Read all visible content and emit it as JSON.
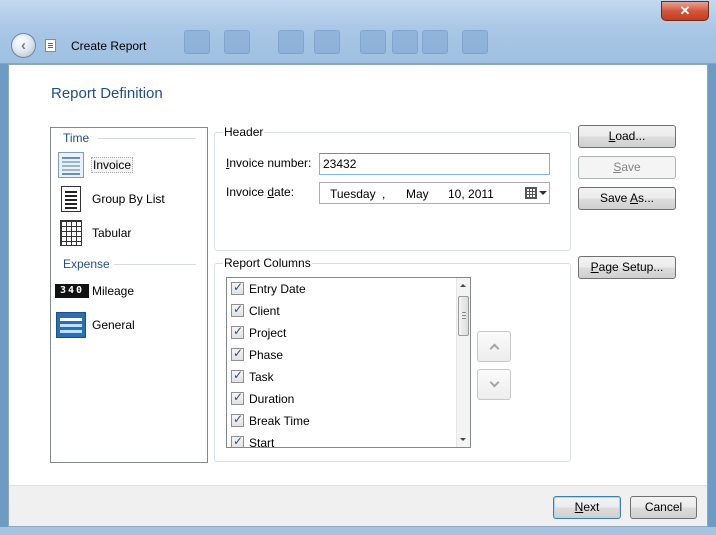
{
  "window": {
    "title": "Create Report",
    "close_glyph": "✕",
    "back_glyph": "‹"
  },
  "page": {
    "title": "Report Definition"
  },
  "categories": {
    "time_header": "Time",
    "expense_header": "Expense",
    "items": [
      {
        "label": "Invoice",
        "icon": "invoice-icon",
        "selected": true
      },
      {
        "label": "Group By List",
        "icon": "list-icon"
      },
      {
        "label": "Tabular",
        "icon": "table-icon"
      },
      {
        "label": "Mileage",
        "icon": "odometer-icon",
        "icon_text": "340"
      },
      {
        "label": "General",
        "icon": "form-icon"
      }
    ]
  },
  "header_group": {
    "title": "Header",
    "invoice_number_label_underlined": "I",
    "invoice_number_label_rest": "nvoice number:",
    "invoice_number_value": "23432",
    "invoice_date_label_a": "Invoice ",
    "invoice_date_label_underlined": "d",
    "invoice_date_label_b": "ate:",
    "date": {
      "weekday": "Tuesday",
      "comma": ",",
      "month": "May",
      "day_year": "10, 2011"
    }
  },
  "columns_group": {
    "title": "Report Columns",
    "items": [
      {
        "label": "Entry Date",
        "checked": true
      },
      {
        "label": "Client",
        "checked": true
      },
      {
        "label": "Project",
        "checked": true
      },
      {
        "label": "Phase",
        "checked": true
      },
      {
        "label": "Task",
        "checked": true
      },
      {
        "label": "Duration",
        "checked": true
      },
      {
        "label": "Break Time",
        "checked": true
      },
      {
        "label": "Start",
        "checked": true
      }
    ]
  },
  "buttons": {
    "load_u": "L",
    "load_rest": "oad...",
    "save_u": "S",
    "save_rest": "ave",
    "saveas_a": "Save ",
    "saveas_u": "A",
    "saveas_b": "s...",
    "pagesetup_a": "",
    "pagesetup_u": "P",
    "pagesetup_b": "age Setup...",
    "next_u": "N",
    "next_rest": "ext",
    "cancel": "Cancel"
  },
  "colors": {
    "accent": "#1f4e8c",
    "check": "#2a4d86"
  }
}
